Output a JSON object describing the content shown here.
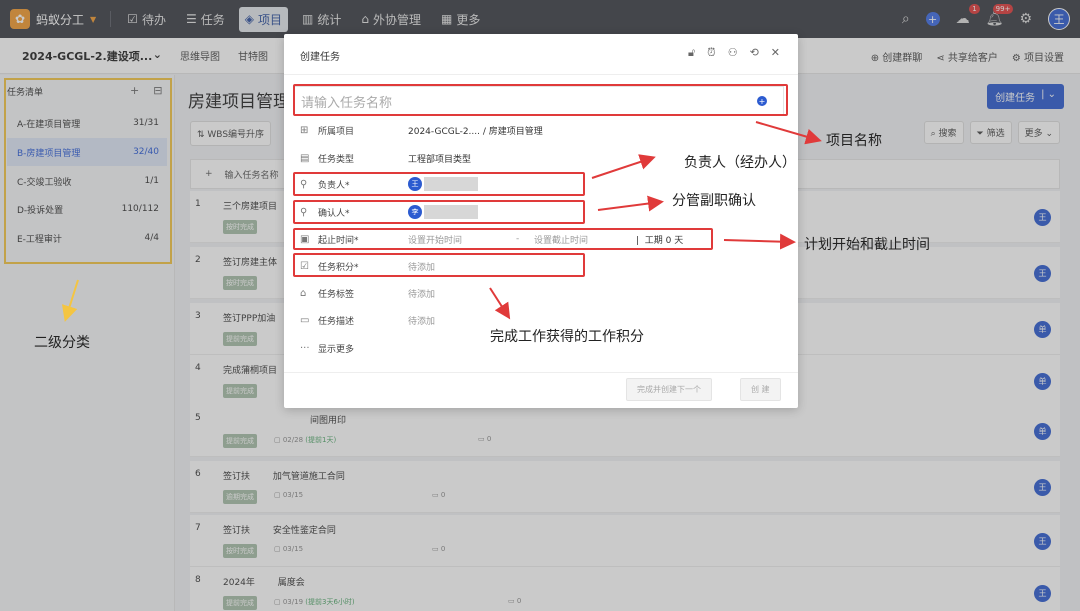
{
  "nav": {
    "brand": "蚂蚁分工",
    "items": [
      {
        "label": "待办",
        "icon": "todo-icon"
      },
      {
        "label": "任务",
        "icon": "task-icon"
      },
      {
        "label": "项目",
        "icon": "project-icon"
      },
      {
        "label": "统计",
        "icon": "stats-icon"
      },
      {
        "label": "外协管理",
        "icon": "outsource-icon"
      },
      {
        "label": "更多",
        "icon": "grid-icon"
      }
    ],
    "activity_badge": "1",
    "notify_badge": "99+",
    "avatar": "王"
  },
  "subbar": {
    "project": "2024-GCGL-2.建设项...",
    "tabs": [
      "思维导图",
      "甘特图"
    ],
    "right": [
      "创建群聊",
      "共享给客户",
      "项目设置"
    ]
  },
  "left": {
    "title": "任务清单",
    "items": [
      {
        "label": "A-在建项目管理",
        "count": "31/31"
      },
      {
        "label": "B-房建项目管理",
        "count": "32/40"
      },
      {
        "label": "C-交竣工验收",
        "count": "1/1"
      },
      {
        "label": "D-投诉处置",
        "count": "110/112"
      },
      {
        "label": "E-工程审计",
        "count": "4/4"
      }
    ]
  },
  "main": {
    "title": "房建项目管理",
    "sort_label": "WBS编号升序",
    "add_placeholder": "输入任务名称",
    "create_btn": "创建任务",
    "search": "搜索",
    "filter": "筛选",
    "more": "更多",
    "rows": [
      {
        "num": "1",
        "title": "三个房建项目",
        "status": "按时完成",
        "date": "",
        "comment": "",
        "avatar": "王"
      },
      {
        "num": "2",
        "title": "签订房建主体",
        "status": "按时完成",
        "date": "",
        "comment": "",
        "avatar": "王"
      },
      {
        "num": "3",
        "title": "签订PPP加油",
        "status": "提前完成",
        "date": "",
        "comment": "",
        "avatar": "单"
      },
      {
        "num": "4",
        "title": "完成蒲桐项目",
        "status": "提前完成",
        "date": "",
        "comment": "",
        "avatar": "单"
      },
      {
        "num": "5",
        "title": "间图用印",
        "status": "提前完成",
        "date": "02/28",
        "date_note": "(提前1天)",
        "comment": "0",
        "avatar": "单"
      },
      {
        "num": "6",
        "title": "签订扶        加气管道施工合同",
        "status": "逾期完成",
        "date": "03/15",
        "date_note": "",
        "comment": "0",
        "avatar": "王"
      },
      {
        "num": "7",
        "title": "签订扶        安全性鉴定合同",
        "status": "按时完成",
        "date": "03/15",
        "date_note": "",
        "comment": "0",
        "avatar": "王"
      },
      {
        "num": "8",
        "title": "2024年        属度会",
        "status": "提前完成",
        "date": "03/19",
        "date_note": "(提前3天6小时)",
        "comment": "0",
        "avatar": "王"
      }
    ]
  },
  "dialog": {
    "title": "创建任务",
    "name_placeholder": "请输入任务名称",
    "fields": [
      {
        "label": "所属项目",
        "value": "2024-GCGL-2.... / 房建项目管理",
        "icon": "grid-icon"
      },
      {
        "label": "任务类型",
        "value": "工程部项目类型",
        "icon": "doc-icon"
      },
      {
        "label": "负责人*",
        "value": "王",
        "icon": "person-icon"
      },
      {
        "label": "确认人*",
        "value": "李",
        "icon": "person-icon"
      },
      {
        "label": "起止时间*",
        "start": "设置开始时间",
        "dash": "-",
        "end": "设置截止时间",
        "duration": "工期 0 天",
        "icon": "calendar-icon"
      },
      {
        "label": "任务积分*",
        "value": "待添加",
        "icon": "score-icon"
      },
      {
        "label": "任务标签",
        "value": "待添加",
        "icon": "tag-icon"
      },
      {
        "label": "任务描述",
        "value": "待添加",
        "icon": "desc-icon"
      },
      {
        "label": "显示更多",
        "value": "",
        "icon": "more-icon"
      }
    ],
    "btn_continue": "完成并创建下一个",
    "btn_create": "创 建"
  },
  "annotations": {
    "project_name": "项目名称",
    "owner": "负责人（经办人）",
    "confirmer": "分管副职确认",
    "time": "计划开始和截止时间",
    "score": "完成工作获得的工作积分",
    "category": "二级分类"
  },
  "colors": {
    "nav_bg": "#3a3d45",
    "accent": "#2c5bd0",
    "annotation_red": "#e03a3a",
    "annotation_yellow": "#f4c542"
  }
}
